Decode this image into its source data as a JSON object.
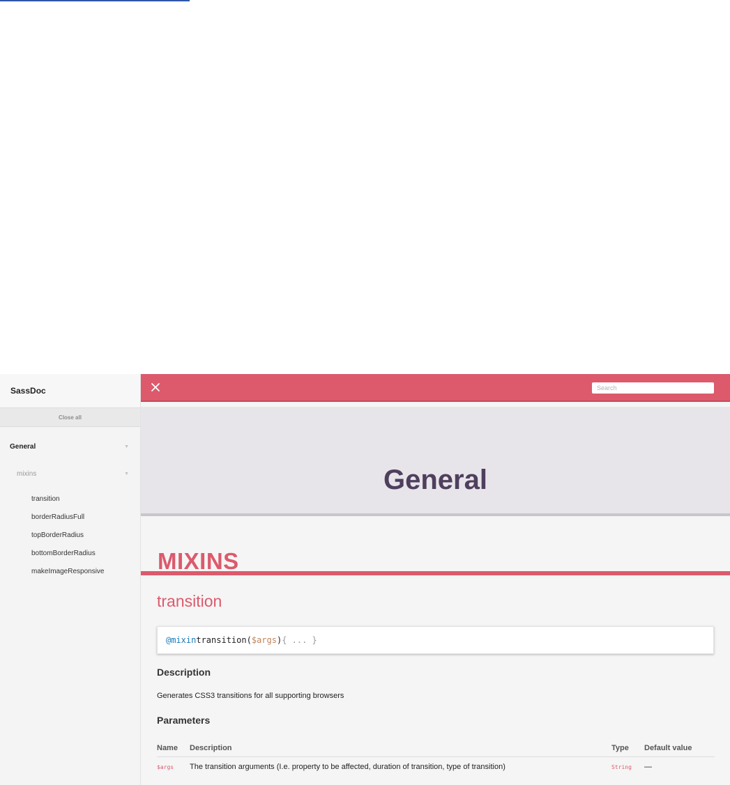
{
  "sidebar": {
    "title": "SassDoc",
    "close_all": "Close all",
    "group": {
      "label": "General",
      "subgroup": {
        "label": "mixins",
        "items": [
          {
            "label": "transition"
          },
          {
            "label": "borderRadiusFull"
          },
          {
            "label": "topBorderRadius"
          },
          {
            "label": "bottomBorderRadius"
          },
          {
            "label": "makeImageResponsive"
          }
        ]
      }
    }
  },
  "topbar": {
    "close_icon": "close-icon",
    "search": {
      "placeholder": "Search",
      "value": ""
    }
  },
  "main": {
    "page_title": "General",
    "section_title": "MIXINS",
    "mixin": {
      "name": "transition",
      "signature": {
        "keyword": "@mixin",
        "name": "transition(",
        "arg": "$args",
        "close_paren": ")",
        "body": "{ ... }"
      },
      "description_heading": "Description",
      "description": "Generates CSS3 transitions for all supporting browsers",
      "parameters_heading": "Parameters",
      "parameters": {
        "columns": [
          "Name",
          "Description",
          "Type",
          "Default value"
        ],
        "rows": [
          {
            "name": "$args",
            "description": "The transition arguments (I.e. property to be affected, duration of transition, type of transition)",
            "type": "String",
            "default": "—"
          }
        ]
      }
    }
  },
  "colors": {
    "accent": "#dc5a6c",
    "title": "#4f3f5d",
    "banner": "#e7e5ea",
    "link_rule": "#2f56a8"
  }
}
